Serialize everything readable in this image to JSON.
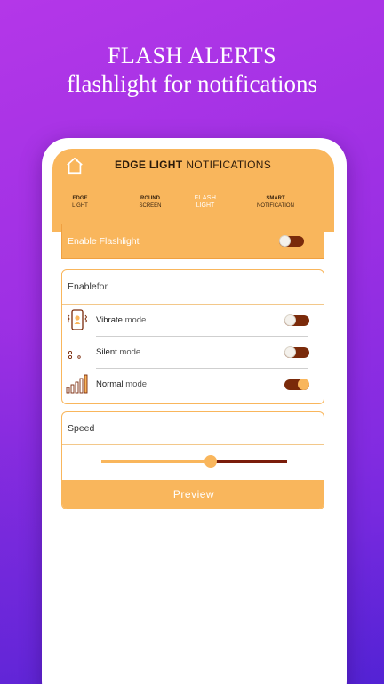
{
  "promo": {
    "title": "FLASH ALERTS",
    "subtitle": "flashlight for notifications"
  },
  "colors": {
    "accent": "#f9b65c",
    "toggle_track": "#7a2a0a",
    "slider_right": "#7a1c0a",
    "background_purple": "#9a2fe3"
  },
  "header": {
    "title_bold": "EDGE LIGHT",
    "title_thin": "NOTIFICATIONS",
    "home_icon": "home-icon"
  },
  "tabs": [
    {
      "line1": "EDGE",
      "line2": "LIGHT",
      "active": false
    },
    {
      "line1": "ROUND",
      "line2": "SCREEN",
      "active": false
    },
    {
      "line1": "FLASH",
      "line2": "LIGHT",
      "active": true
    },
    {
      "line1": "SMART",
      "line2": "NOTIFICATION",
      "active": false
    }
  ],
  "enable_flashlight": {
    "label_a": "Enable",
    "label_b": " Flashlight",
    "on": false
  },
  "enable_for": {
    "title_a": "Enable",
    "title_b": " for",
    "modes": [
      {
        "name": "Vibrate",
        "suffix": " mode",
        "icon": "vibrate-phone-icon",
        "on": false
      },
      {
        "name": "Silent",
        "suffix": " mode",
        "icon": "silent-icon",
        "on": false
      },
      {
        "name": "Normal",
        "suffix": " mode",
        "icon": "volume-bars-icon",
        "on": true
      }
    ]
  },
  "speed": {
    "title": "Speed",
    "value_fraction": 0.59,
    "preview_label": "Preview"
  }
}
